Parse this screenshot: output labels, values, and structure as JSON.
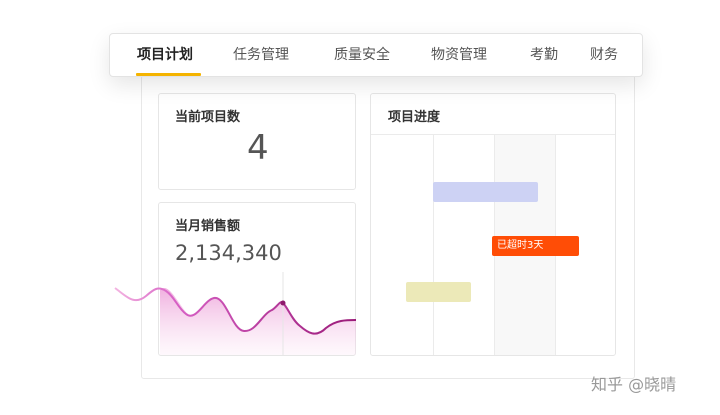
{
  "tabs": [
    {
      "label": "项目计划",
      "active": true
    },
    {
      "label": "任务管理",
      "active": false
    },
    {
      "label": "质量安全",
      "active": false
    },
    {
      "label": "物资管理",
      "active": false
    },
    {
      "label": "考勤",
      "active": false
    },
    {
      "label": "财务",
      "active": false
    }
  ],
  "current_projects": {
    "title": "当前项目数",
    "value": "4"
  },
  "monthly_sales": {
    "title": "当月销售额",
    "value": "2,134,340"
  },
  "progress": {
    "title": "项目进度",
    "overdue_label": "已超时3天",
    "colors": {
      "bar1": "#cdd2f4",
      "bar2": "#ff4d06",
      "bar3": "#ece9b8",
      "accent": "#f5b400"
    }
  },
  "watermark": "知乎 @晓晴"
}
